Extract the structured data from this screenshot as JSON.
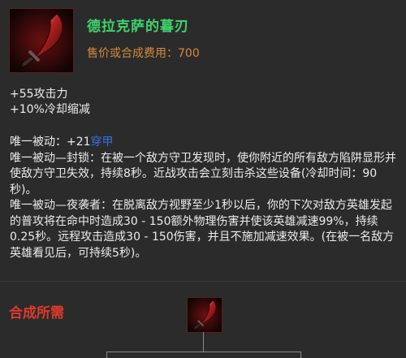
{
  "item": {
    "name": "德拉克萨的暮刃",
    "cost": "售价或合成费用：700",
    "icon": "dusk-blade-icon"
  },
  "stats": [
    "+55攻击力",
    "+10%冷却缩减"
  ],
  "passives": {
    "p1_prefix": "唯一被动：+21",
    "p1_link": "穿甲",
    "p2": "唯一被动—封锁：在被一个敌方守卫发现时，使你附近的所有敌方陷阱显形并使敌方守卫失效，持续8秒。近战攻击会立刻击杀这些设备(冷却时间：90秒)。",
    "p3": "唯一被动—夜袭者：在脱离敌方视野至少1秒以后，你的下次对敌方英雄发起的普攻将在命中时造成30 - 150额外物理伤害并使该英雄减速99%，持续0.25秒。远程攻击造成30 - 150伤害，并且不施加减速效果。(在被一名敌方英雄看见后，可持续5秒)。"
  },
  "recipe": {
    "title": "合成所需",
    "icon": "dusk-blade-icon"
  },
  "colors": {
    "name": "#3fd36b",
    "cost": "#d58b3f",
    "recipe_title": "#e0392b",
    "link": "#3a6fe0"
  }
}
